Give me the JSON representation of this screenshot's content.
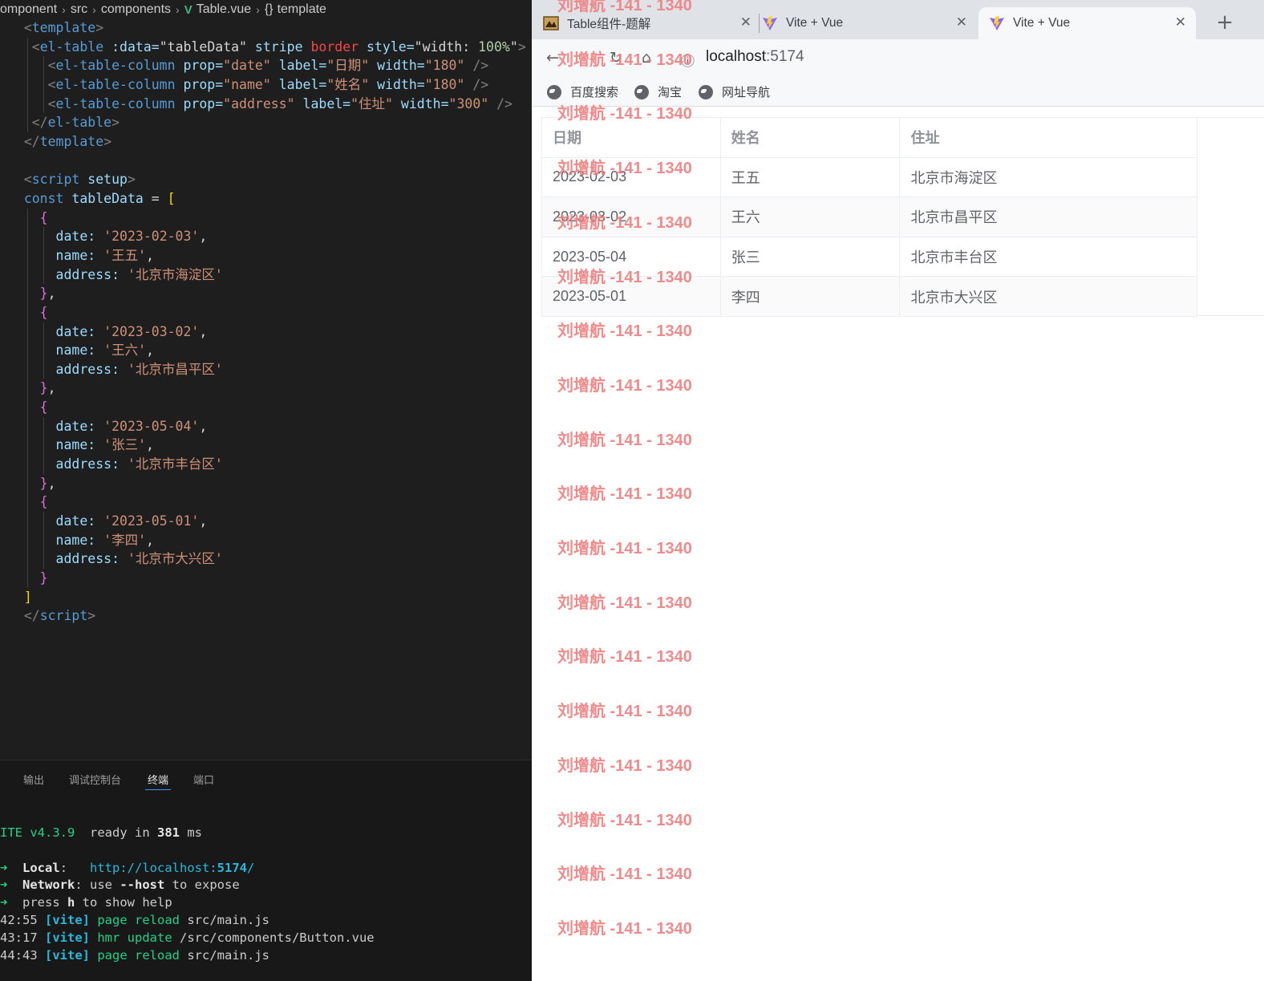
{
  "breadcrumb": [
    "omponent",
    "src",
    "components",
    "Table.vue",
    "template"
  ],
  "code_lines": [
    [
      [
        "   ",
        "w"
      ],
      [
        "<",
        "pun"
      ],
      [
        "template",
        "tag"
      ],
      [
        ">",
        "pun"
      ]
    ],
    [
      [
        "    ",
        "w"
      ],
      [
        "<",
        "pun"
      ],
      [
        "el-table",
        "tag"
      ],
      [
        " :data=",
        "attr"
      ],
      [
        "\"tableData\"",
        "white"
      ],
      [
        " stripe ",
        "attr"
      ],
      [
        "border",
        "red"
      ],
      [
        " style=",
        "attr"
      ],
      [
        "\"width: ",
        "white"
      ],
      [
        "100%",
        "num"
      ],
      [
        "\"",
        "white"
      ],
      [
        ">",
        "pun"
      ]
    ],
    [
      [
        "      ",
        "w"
      ],
      [
        "<",
        "pun"
      ],
      [
        "el-table-column",
        "tag"
      ],
      [
        " prop=",
        "attr"
      ],
      [
        "\"date\"",
        "str"
      ],
      [
        " label=",
        "attr"
      ],
      [
        "\"日期\"",
        "str"
      ],
      [
        " width=",
        "attr"
      ],
      [
        "\"180\"",
        "str"
      ],
      [
        " />",
        "pun"
      ]
    ],
    [
      [
        "      ",
        "w"
      ],
      [
        "<",
        "pun"
      ],
      [
        "el-table-column",
        "tag"
      ],
      [
        " prop=",
        "attr"
      ],
      [
        "\"name\"",
        "str"
      ],
      [
        " label=",
        "attr"
      ],
      [
        "\"姓名\"",
        "str"
      ],
      [
        " width=",
        "attr"
      ],
      [
        "\"180\"",
        "str"
      ],
      [
        " />",
        "pun"
      ]
    ],
    [
      [
        "      ",
        "w"
      ],
      [
        "<",
        "pun"
      ],
      [
        "el-table-column",
        "tag"
      ],
      [
        " prop=",
        "attr"
      ],
      [
        "\"address\"",
        "str"
      ],
      [
        " label=",
        "attr"
      ],
      [
        "\"住址\"",
        "str"
      ],
      [
        " width=",
        "attr"
      ],
      [
        "\"300\"",
        "str"
      ],
      [
        " />",
        "pun"
      ]
    ],
    [
      [
        "    ",
        "w"
      ],
      [
        "</",
        "pun"
      ],
      [
        "el-table",
        "tag"
      ],
      [
        ">",
        "pun"
      ]
    ],
    [
      [
        "   ",
        "w"
      ],
      [
        "</",
        "pun"
      ],
      [
        "template",
        "tag"
      ],
      [
        ">",
        "pun"
      ]
    ],
    [
      [
        "",
        "w"
      ]
    ],
    [
      [
        "   ",
        "w"
      ],
      [
        "<",
        "pun"
      ],
      [
        "script",
        "tag"
      ],
      [
        " setup",
        "attr"
      ],
      [
        ">",
        "pun"
      ]
    ],
    [
      [
        "   ",
        "w"
      ],
      [
        "const",
        "kw"
      ],
      [
        " tableData",
        "attr"
      ],
      [
        " = ",
        "white"
      ],
      [
        "[",
        "br1"
      ]
    ],
    [
      [
        "     ",
        "w"
      ],
      [
        "{",
        "br2"
      ]
    ],
    [
      [
        "       ",
        "w"
      ],
      [
        "date: ",
        "attr"
      ],
      [
        "'2023-02-03'",
        "str"
      ],
      [
        ",",
        "white"
      ]
    ],
    [
      [
        "       ",
        "w"
      ],
      [
        "name: ",
        "attr"
      ],
      [
        "'王五'",
        "str"
      ],
      [
        ",",
        "white"
      ]
    ],
    [
      [
        "       ",
        "w"
      ],
      [
        "address: ",
        "attr"
      ],
      [
        "'北京市海淀区'",
        "str"
      ]
    ],
    [
      [
        "     ",
        "w"
      ],
      [
        "}",
        "br2"
      ],
      [
        ",",
        "white"
      ]
    ],
    [
      [
        "     ",
        "w"
      ],
      [
        "{",
        "br2"
      ]
    ],
    [
      [
        "       ",
        "w"
      ],
      [
        "date: ",
        "attr"
      ],
      [
        "'2023-03-02'",
        "str"
      ],
      [
        ",",
        "white"
      ]
    ],
    [
      [
        "       ",
        "w"
      ],
      [
        "name: ",
        "attr"
      ],
      [
        "'王六'",
        "str"
      ],
      [
        ",",
        "white"
      ]
    ],
    [
      [
        "       ",
        "w"
      ],
      [
        "address: ",
        "attr"
      ],
      [
        "'北京市昌平区'",
        "str"
      ]
    ],
    [
      [
        "     ",
        "w"
      ],
      [
        "}",
        "br2"
      ],
      [
        ",",
        "white"
      ]
    ],
    [
      [
        "     ",
        "w"
      ],
      [
        "{",
        "br2"
      ]
    ],
    [
      [
        "       ",
        "w"
      ],
      [
        "date: ",
        "attr"
      ],
      [
        "'2023-05-04'",
        "str"
      ],
      [
        ",",
        "white"
      ]
    ],
    [
      [
        "       ",
        "w"
      ],
      [
        "name: ",
        "attr"
      ],
      [
        "'张三'",
        "str"
      ],
      [
        ",",
        "white"
      ]
    ],
    [
      [
        "       ",
        "w"
      ],
      [
        "address: ",
        "attr"
      ],
      [
        "'北京市丰台区'",
        "str"
      ]
    ],
    [
      [
        "     ",
        "w"
      ],
      [
        "}",
        "br2"
      ],
      [
        ",",
        "white"
      ]
    ],
    [
      [
        "     ",
        "w"
      ],
      [
        "{",
        "br2"
      ]
    ],
    [
      [
        "       ",
        "w"
      ],
      [
        "date: ",
        "attr"
      ],
      [
        "'2023-05-01'",
        "str"
      ],
      [
        ",",
        "white"
      ]
    ],
    [
      [
        "       ",
        "w"
      ],
      [
        "name: ",
        "attr"
      ],
      [
        "'李四'",
        "str"
      ],
      [
        ",",
        "white"
      ]
    ],
    [
      [
        "       ",
        "w"
      ],
      [
        "address: ",
        "attr"
      ],
      [
        "'北京市大兴区'",
        "str"
      ]
    ],
    [
      [
        "     ",
        "w"
      ],
      [
        "}",
        "br2"
      ]
    ],
    [
      [
        "   ",
        "w"
      ],
      [
        "]",
        "br1"
      ]
    ],
    [
      [
        "   ",
        "w"
      ],
      [
        "</",
        "pun"
      ],
      [
        "script",
        "tag"
      ],
      [
        ">",
        "pun"
      ]
    ]
  ],
  "panel_tabs": [
    "输出",
    "调试控制台",
    "终端",
    "端口"
  ],
  "terminal_lines": [
    [
      [
        "ITE v4.3.9",
        "green"
      ],
      [
        "  ready in ",
        "plain"
      ],
      [
        "381",
        "bold"
      ],
      [
        " ms",
        "plain"
      ]
    ],
    [
      [
        "",
        "plain"
      ]
    ],
    [
      [
        "➜",
        "green"
      ],
      [
        "  ",
        "plain"
      ],
      [
        "Local",
        "bold"
      ],
      [
        ":   ",
        "plain"
      ],
      [
        "http://localhost:",
        "cyan"
      ],
      [
        "5174",
        "cyanbold"
      ],
      [
        "/",
        "cyan"
      ]
    ],
    [
      [
        "➜",
        "green"
      ],
      [
        "  ",
        "plain"
      ],
      [
        "Network",
        "bold"
      ],
      [
        ": use ",
        "plain"
      ],
      [
        "--host",
        "bold"
      ],
      [
        " to expose",
        "plain"
      ]
    ],
    [
      [
        "➜",
        "green"
      ],
      [
        "  press ",
        "plain"
      ],
      [
        "h",
        "bold"
      ],
      [
        " to show help",
        "plain"
      ]
    ],
    [
      [
        "42:55 ",
        "plain"
      ],
      [
        "[vite]",
        "cyanbold"
      ],
      [
        " page reload ",
        "green"
      ],
      [
        "src/main.js",
        "plain"
      ]
    ],
    [
      [
        "43:17 ",
        "plain"
      ],
      [
        "[vite]",
        "cyanbold"
      ],
      [
        " hmr update ",
        "green"
      ],
      [
        "/src/components/Button.vue",
        "plain"
      ]
    ],
    [
      [
        "44:43 ",
        "plain"
      ],
      [
        "[vite]",
        "cyanbold"
      ],
      [
        " page reload ",
        "green"
      ],
      [
        "src/main.js",
        "plain"
      ]
    ]
  ],
  "browser": {
    "tabs": [
      {
        "title": "Table组件-题解",
        "icon": "favicon-image-icon"
      },
      {
        "title": "Vite + Vue",
        "icon": "vite-icon"
      },
      {
        "title": "Vite + Vue",
        "icon": "vite-icon"
      }
    ],
    "new_tab": "+",
    "url_host": "localhost",
    "url_port": ":5174",
    "bookmarks": [
      "百度搜索",
      "淘宝",
      "网址导航"
    ]
  },
  "table": {
    "headers": [
      "日期",
      "姓名",
      "住址"
    ],
    "rows": [
      [
        "2023-02-03",
        "王五",
        "北京市海淀区"
      ],
      [
        "2023-03-02",
        "王六",
        "北京市昌平区"
      ],
      [
        "2023-05-04",
        "张三",
        "北京市丰台区"
      ],
      [
        "2023-05-01",
        "李四",
        "北京市大兴区"
      ]
    ]
  },
  "watermark_text": "刘增航 -141 - 1340",
  "colors": {
    "vue_green": "#41b883",
    "terminal_green": "#23d18b",
    "terminal_cyan": "#29b8db",
    "watermark": "#f07f7f"
  }
}
